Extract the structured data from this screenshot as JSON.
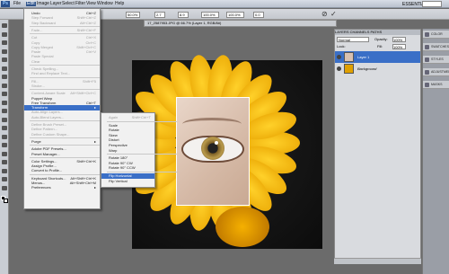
{
  "menubar": {
    "logo": "Ps",
    "items": [
      "File",
      "Edit",
      "Image",
      "Layer",
      "Select",
      "Filter",
      "View",
      "Window",
      "Help"
    ],
    "workspace": "ESSENTIALS ▾"
  },
  "options": {
    "zoom": "50.0%",
    "x": "2.7",
    "y": "8.9",
    "w": "100.0%",
    "h": "100.0%",
    "angle": "0.0"
  },
  "document": {
    "tab": "17_2587953.JPG @ 66.7% (Layer 1, RGB/8#)"
  },
  "edit_menu": [
    {
      "label": "Undo",
      "shortcut": "Ctrl+Z",
      "disabled": false
    },
    {
      "label": "Step Forward",
      "shortcut": "Shift+Ctrl+Z",
      "disabled": true
    },
    {
      "label": "Step Backward",
      "shortcut": "Alt+Ctrl+Z",
      "disabled": true
    },
    {
      "sep": true
    },
    {
      "label": "Fade...",
      "shortcut": "Shift+Ctrl+F",
      "disabled": true
    },
    {
      "sep": true
    },
    {
      "label": "Cut",
      "shortcut": "Ctrl+X",
      "disabled": true
    },
    {
      "label": "Copy",
      "shortcut": "Ctrl+C",
      "disabled": true
    },
    {
      "label": "Copy Merged",
      "shortcut": "Shift+Ctrl+C",
      "disabled": true
    },
    {
      "label": "Paste",
      "shortcut": "Ctrl+V",
      "disabled": true
    },
    {
      "label": "Paste Special",
      "shortcut": "",
      "disabled": true
    },
    {
      "label": "Clear",
      "shortcut": "",
      "disabled": true
    },
    {
      "sep": true
    },
    {
      "label": "Check Spelling...",
      "shortcut": "",
      "disabled": true
    },
    {
      "label": "Find and Replace Text...",
      "shortcut": "",
      "disabled": true
    },
    {
      "sep": true
    },
    {
      "label": "Fill...",
      "shortcut": "Shift+F5",
      "disabled": true
    },
    {
      "label": "Stroke...",
      "shortcut": "",
      "disabled": true
    },
    {
      "sep": true
    },
    {
      "label": "Content-Aware Scale",
      "shortcut": "Alt+Shift+Ctrl+C",
      "disabled": true
    },
    {
      "label": "Puppet Warp",
      "shortcut": "",
      "disabled": false
    },
    {
      "label": "Free Transform",
      "shortcut": "Ctrl+T",
      "disabled": false
    },
    {
      "label": "Transform",
      "shortcut": "▸",
      "disabled": false,
      "highlight": true
    },
    {
      "label": "Auto-Align Layers...",
      "shortcut": "",
      "disabled": true
    },
    {
      "label": "Auto-Blend Layers...",
      "shortcut": "",
      "disabled": true
    },
    {
      "sep": true
    },
    {
      "label": "Define Brush Preset...",
      "shortcut": "",
      "disabled": true
    },
    {
      "label": "Define Pattern...",
      "shortcut": "",
      "disabled": true
    },
    {
      "label": "Define Custom Shape...",
      "shortcut": "",
      "disabled": true
    },
    {
      "sep": true
    },
    {
      "label": "Purge",
      "shortcut": "▸",
      "disabled": false
    },
    {
      "sep": true
    },
    {
      "label": "Adobe PDF Presets...",
      "shortcut": "",
      "disabled": false
    },
    {
      "label": "Preset Manager...",
      "shortcut": "",
      "disabled": false
    },
    {
      "sep": true
    },
    {
      "label": "Color Settings...",
      "shortcut": "Shift+Ctrl+K",
      "disabled": false
    },
    {
      "label": "Assign Profile...",
      "shortcut": "",
      "disabled": false
    },
    {
      "label": "Convert to Profile...",
      "shortcut": "",
      "disabled": false
    },
    {
      "sep": true
    },
    {
      "label": "Keyboard Shortcuts...",
      "shortcut": "Alt+Shift+Ctrl+K",
      "disabled": false
    },
    {
      "label": "Menus...",
      "shortcut": "Alt+Shift+Ctrl+M",
      "disabled": false
    },
    {
      "label": "Preferences",
      "shortcut": "▸",
      "disabled": false
    }
  ],
  "transform_menu": [
    {
      "label": "Again",
      "shortcut": "Shift+Ctrl+T",
      "disabled": true
    },
    {
      "sep": true
    },
    {
      "label": "Scale",
      "disabled": false
    },
    {
      "label": "Rotate",
      "disabled": false
    },
    {
      "label": "Skew",
      "disabled": false
    },
    {
      "label": "Distort",
      "disabled": false
    },
    {
      "label": "Perspective",
      "disabled": false
    },
    {
      "label": "Warp",
      "disabled": false
    },
    {
      "sep": true
    },
    {
      "label": "Rotate 180°",
      "disabled": false
    },
    {
      "label": "Rotate 90° CW",
      "disabled": false
    },
    {
      "label": "Rotate 90° CCW",
      "disabled": false
    },
    {
      "sep": true
    },
    {
      "label": "Flip Horizontal",
      "disabled": false,
      "highlight": true
    },
    {
      "label": "Flip Vertical",
      "disabled": false
    }
  ],
  "layers": {
    "tabs": "LAYERS  CHANNELS  PATHS",
    "blend": "Normal",
    "opacity_label": "Opacity:",
    "opacity": "100%",
    "lock_label": "Lock:",
    "fill_label": "Fill:",
    "fill": "100%",
    "items": [
      {
        "name": "Layer 1"
      },
      {
        "name": "Background"
      }
    ]
  },
  "dock": [
    "COLOR",
    "SWATCHES",
    "STYLES",
    "ADJUSTMENTS",
    "MASKS"
  ],
  "colors": {
    "accent": "#3a6fc7"
  }
}
